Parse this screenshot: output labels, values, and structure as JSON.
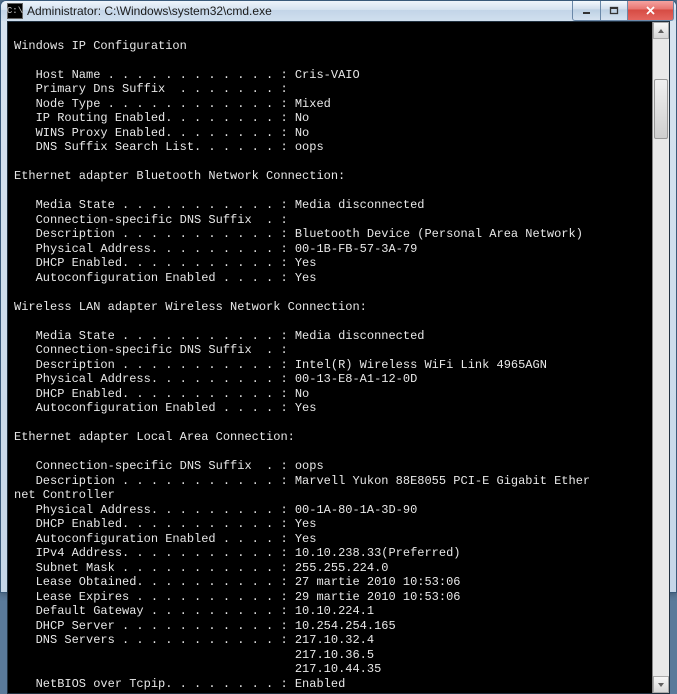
{
  "window": {
    "title": "Administrator: C:\\Windows\\system32\\cmd.exe",
    "icon_glyph": "C:\\"
  },
  "sections": {
    "ipconfig_header": "Windows IP Configuration",
    "win": {
      "host_name": "Cris-VAIO",
      "primary_dns_suffix": "",
      "node_type": "Mixed",
      "ip_routing": "No",
      "wins_proxy": "No",
      "dns_suffix_search": "oops"
    },
    "bt_header": "Ethernet adapter Bluetooth Network Connection:",
    "bt": {
      "media_state": "Media disconnected",
      "conn_dns_suffix": "",
      "description": "Bluetooth Device (Personal Area Network)",
      "phys_addr": "00-1B-FB-57-3A-79",
      "dhcp": "Yes",
      "autoconf": "Yes"
    },
    "wlan_header": "Wireless LAN adapter Wireless Network Connection:",
    "wlan": {
      "media_state": "Media disconnected",
      "conn_dns_suffix": "",
      "description": "Intel(R) Wireless WiFi Link 4965AGN",
      "phys_addr": "00-13-E8-A1-12-0D",
      "dhcp": "No",
      "autoconf": "Yes"
    },
    "lan_header": "Ethernet adapter Local Area Connection:",
    "lan": {
      "conn_dns_suffix": "oops",
      "description_l1": "Marvell Yukon 88E8055 PCI-E Gigabit Ether",
      "description_l2": "net Controller",
      "phys_addr": "00-1A-80-1A-3D-90",
      "dhcp": "Yes",
      "autoconf": "Yes",
      "ipv4": "10.10.238.33(Preferred)",
      "subnet": "255.255.224.0",
      "lease_obtained": "27 martie 2010 10:53:06",
      "lease_expires": "29 martie 2010 10:53:06",
      "gateway": "10.10.224.1",
      "dhcp_server": "10.254.254.165",
      "dns1": "217.10.32.4",
      "dns2": "217.10.36.5",
      "dns3": "217.10.44.35",
      "netbios": "Enabled"
    }
  }
}
